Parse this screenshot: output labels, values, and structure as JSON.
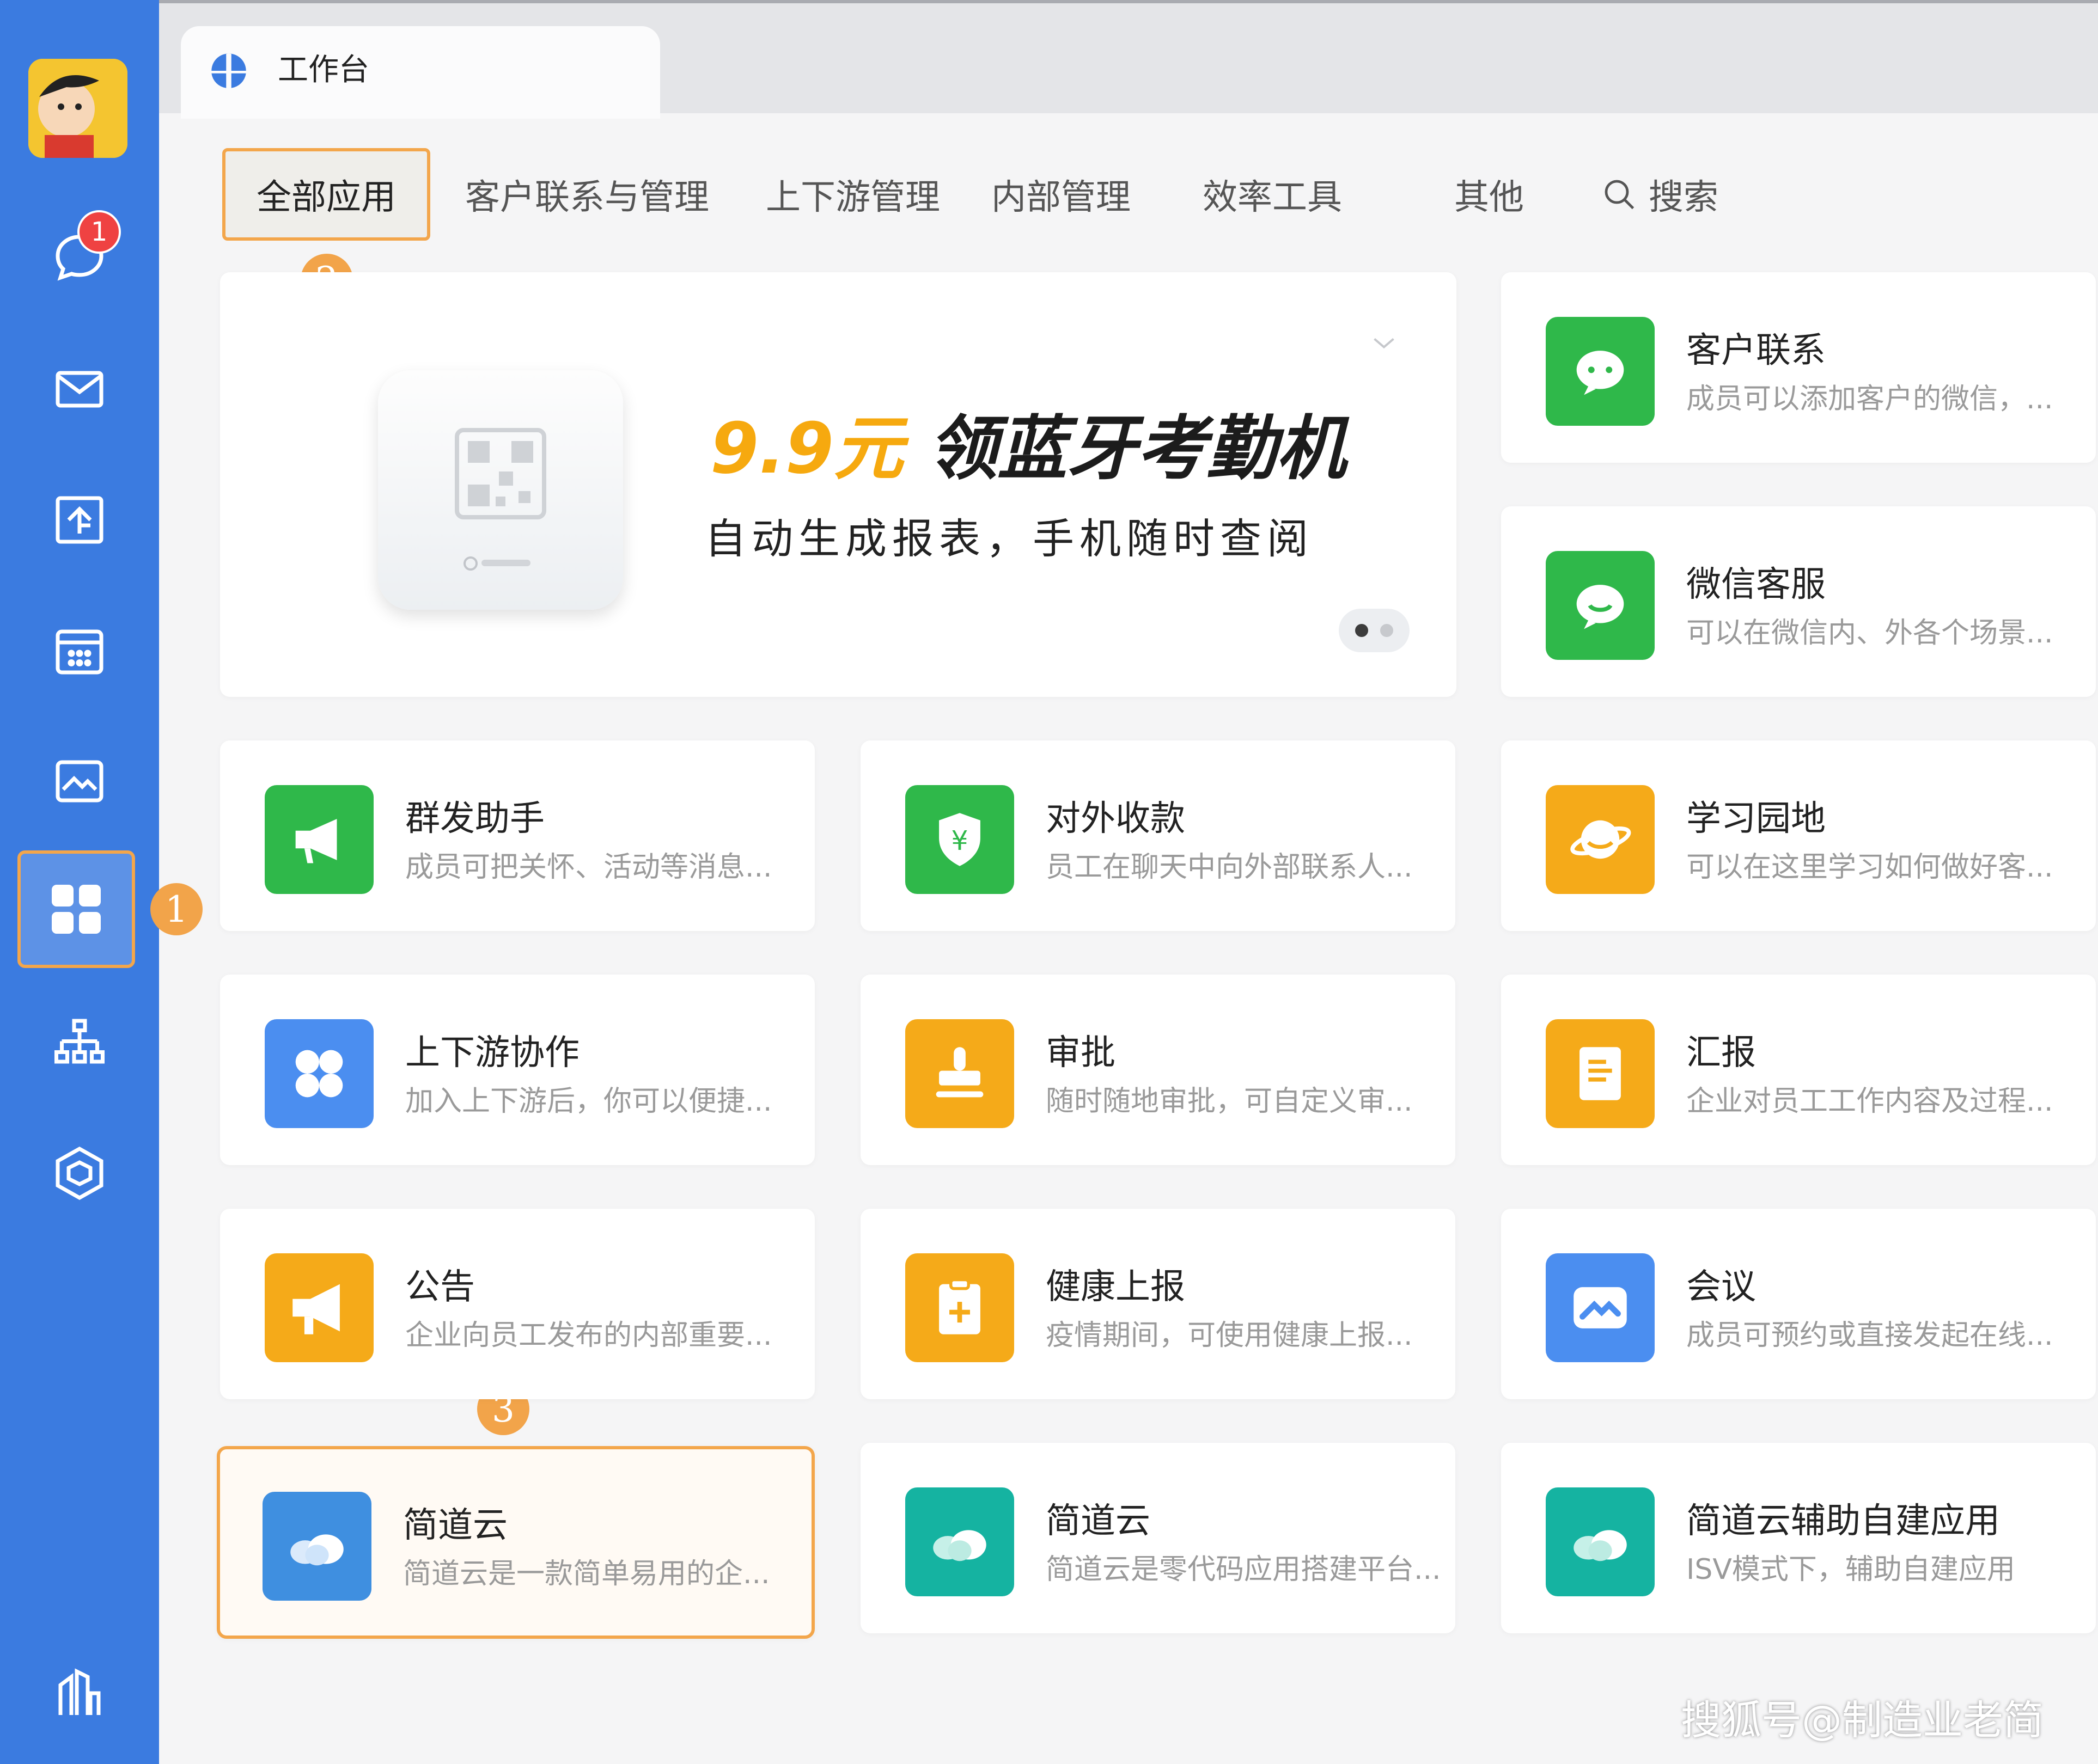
{
  "window": {
    "title": "工作台"
  },
  "sidebar": {
    "unread_badge": "1",
    "icons": [
      "chat-icon",
      "mail-icon",
      "docs-icon",
      "calendar-icon",
      "photo-icon",
      "workbench-icon",
      "org-chart-icon",
      "box-icon",
      "bottom-app-icon"
    ]
  },
  "callouts": {
    "one": "1",
    "two": "2",
    "three": "3"
  },
  "categories": [
    "全部应用",
    "客户联系与管理",
    "上下游管理",
    "内部管理",
    "效率工具",
    "其他"
  ],
  "search": {
    "label": "搜索"
  },
  "banner": {
    "price": "9.9元",
    "title": "领蓝牙考勤机",
    "subtitle": "自动生成报表，手机随时查阅",
    "slide_count": 2,
    "active_slide": 1
  },
  "apps": [
    {
      "name": "客户联系",
      "desc": "成员可以添加客户的微信，..."
    },
    {
      "name": "微信客服",
      "desc": "可以在微信内、外各个场景..."
    },
    {
      "name": "群发助手",
      "desc": "成员可把关怀、活动等消息..."
    },
    {
      "name": "对外收款",
      "desc": "员工在聊天中向外部联系人..."
    },
    {
      "name": "学习园地",
      "desc": "可以在这里学习如何做好客..."
    },
    {
      "name": "上下游协作",
      "desc": "加入上下游后，你可以便捷..."
    },
    {
      "name": "审批",
      "desc": "随时随地审批，可自定义审..."
    },
    {
      "name": "汇报",
      "desc": "企业对员工工作内容及过程..."
    },
    {
      "name": "公告",
      "desc": "企业向员工发布的内部重要..."
    },
    {
      "name": "健康上报",
      "desc": "疫情期间，可使用健康上报..."
    },
    {
      "name": "会议",
      "desc": "成员可预约或直接发起在线..."
    },
    {
      "name": "简道云",
      "desc": "简道云是一款简单易用的企..."
    },
    {
      "name": "简道云",
      "desc": "简道云是零代码应用搭建平台..."
    },
    {
      "name": "简道云辅助自建应用",
      "desc": "ISV模式下，辅助自建应用"
    }
  ],
  "colors": {
    "sidebar": "#3b7be0",
    "highlight": "#f3a64b",
    "green": "#2fb84a",
    "orange": "#f5aa19",
    "blue": "#4b8ef0",
    "teal": "#15b3a1"
  },
  "watermark": "搜狐号@制造业老简"
}
